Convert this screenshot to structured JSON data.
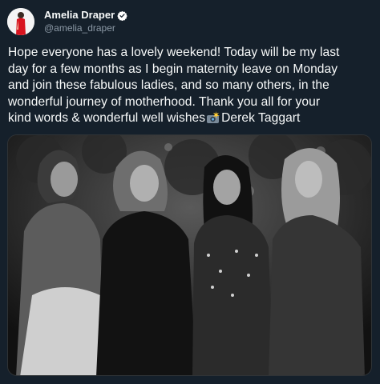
{
  "tweet": {
    "display_name": "Amelia Draper",
    "handle": "@amelia_draper",
    "verified": true,
    "text_lines": [
      "Hope everyone has a lovely weekend! Today will be my last",
      "day for a few months as I begin maternity leave on Monday",
      "and join these fabulous ladies, and so many others, in the",
      "wonderful journey of motherhood. Thank you all for your",
      "kind words & wonderful well wishes",
      "Derek Taggart"
    ],
    "emoji": "camera-with-flash",
    "photo": {
      "description_icon": "photo-image"
    }
  },
  "colors": {
    "background": "#15202b",
    "text": "#f7f9f9",
    "secondary_text": "#8b98a5",
    "verified_badge": "#ffffff"
  }
}
